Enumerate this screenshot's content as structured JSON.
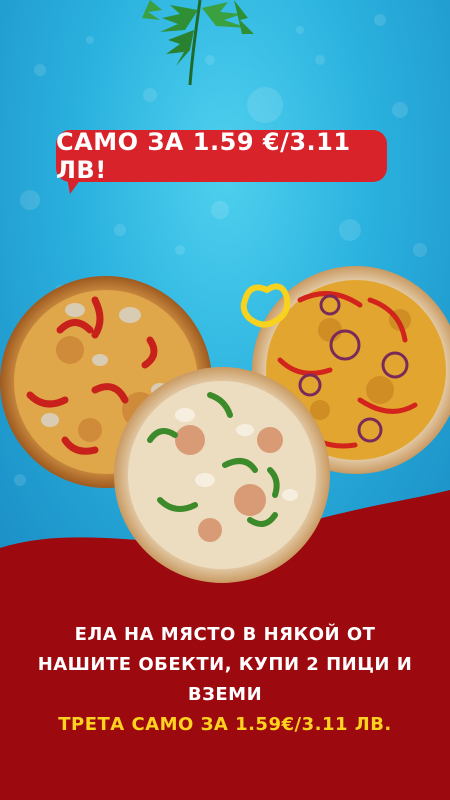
{
  "promo": {
    "price_badge": "САМО ЗА 1.59 €/3.11 ЛВ!",
    "line1": "ЕЛА НА МЯСТО В НЯКОЙ ОТ",
    "line2": "НАШИТЕ ОБЕКТИ, КУПИ 2 ПИЦИ И ВЗЕМИ",
    "line3": "ТРЕТА САМО ЗА 1.59€/3.11 ЛВ."
  },
  "colors": {
    "sky_blue": "#2bb2df",
    "badge_red": "#d8232a",
    "bottom_red": "#9c0a10",
    "highlight_yellow": "#ffd21f"
  },
  "images": [
    "arugula-leaves",
    "pizza-mushroom-pepper",
    "pizza-green-pepper",
    "pizza-chicken-onion",
    "yellow-pepper-ring"
  ]
}
